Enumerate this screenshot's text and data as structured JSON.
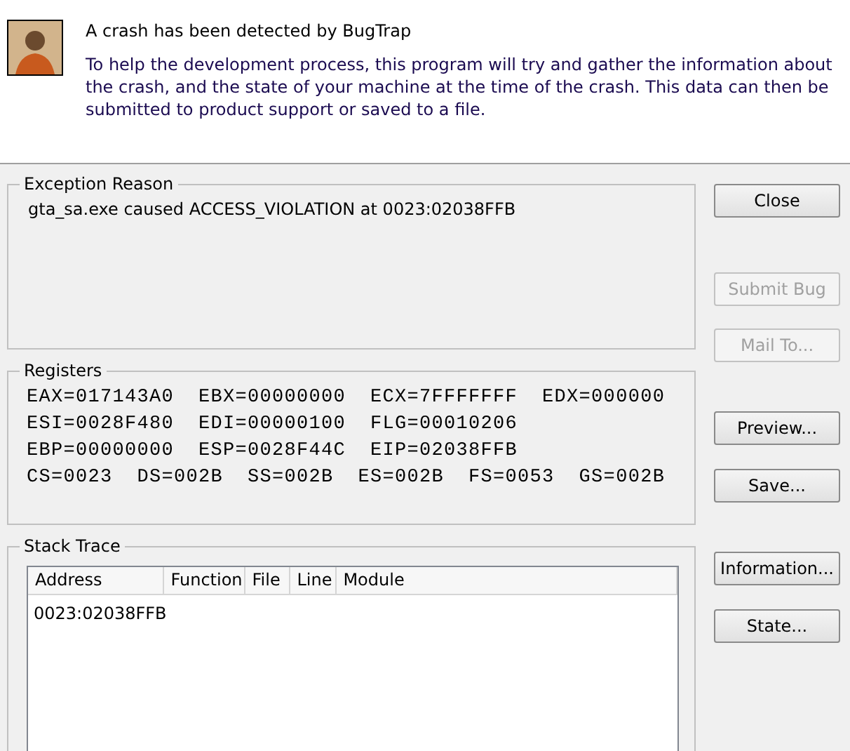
{
  "header": {
    "title": "A crash has been detected by BugTrap",
    "description": "To help the development process, this program will try and gather the information about the crash, and the state of your machine at the time of the crash. This data can then be submitted to product support or saved to a file."
  },
  "exception_reason": {
    "label": "Exception Reason",
    "text": "gta_sa.exe caused ACCESS_VIOLATION at 0023:02038FFB"
  },
  "registers": {
    "label": "Registers",
    "lines": [
      "EAX=017143A0  EBX=00000000  ECX=7FFFFFFF  EDX=000000",
      "ESI=0028F480  EDI=00000100  FLG=00010206",
      "EBP=00000000  ESP=0028F44C  EIP=02038FFB",
      "CS=0023  DS=002B  SS=002B  ES=002B  FS=0053  GS=002B"
    ]
  },
  "stack_trace": {
    "label": "Stack Trace",
    "columns": [
      "Address",
      "Function",
      "File",
      "Line",
      "Module"
    ],
    "rows": [
      [
        "0023:02038FFB",
        "",
        "",
        "",
        ""
      ]
    ]
  },
  "buttons": [
    {
      "label": "Close",
      "disabled": false
    },
    {
      "label": "Submit Bug",
      "disabled": true
    },
    {
      "label": "Mail To...",
      "disabled": true
    },
    {
      "label": "Preview...",
      "disabled": false
    },
    {
      "label": "Save...",
      "disabled": false
    },
    {
      "label": "Information...",
      "disabled": false
    },
    {
      "label": "State...",
      "disabled": false
    }
  ]
}
